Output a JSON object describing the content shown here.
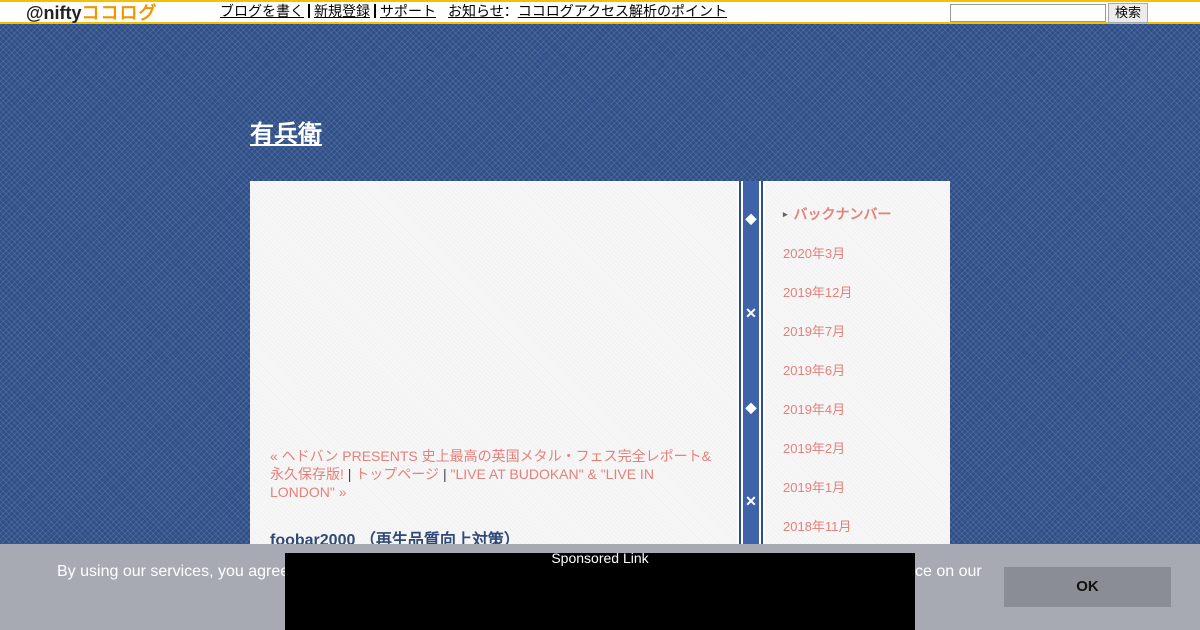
{
  "topbar": {
    "logo_at": "@nifty",
    "logo_brand": "ココログ",
    "links": [
      "ブログを書く",
      "新規登録",
      "サポート"
    ],
    "notice_label": "お知らせ",
    "notice_separator": "：",
    "notice_link": "ココログアクセス解析のポイント",
    "search_placeholder": "",
    "search_button": "検索"
  },
  "blog": {
    "title": "有兵衛"
  },
  "post": {
    "prev_link": "« ヘドバン PRESENTS 史上最高の英国メタル・フェス完全レポート&永久保存版!",
    "separator": "|",
    "top_link": "トップページ",
    "next_link": "\"LIVE AT BUDOKAN\" & \"LIVE IN LONDON\" »",
    "title": "foobar2000 （再生品質向上対策）"
  },
  "sidebar": {
    "heading": "バックナンバー",
    "bullet": "▸",
    "archives": [
      "2020年3月",
      "2019年12月",
      "2019年7月",
      "2019年6月",
      "2019年4月",
      "2019年2月",
      "2019年1月",
      "2018年11月"
    ]
  },
  "cookie": {
    "text_left": "By using our services, you agree",
    "text_right": "ce on our",
    "ok_button": "OK"
  },
  "ad": {
    "label": "Sponsored Link"
  },
  "colors": {
    "page_background": "#2f4f88",
    "link_accent": "#e5807b",
    "topbar_border": "#f2c200",
    "logo_brand": "#f29600"
  }
}
